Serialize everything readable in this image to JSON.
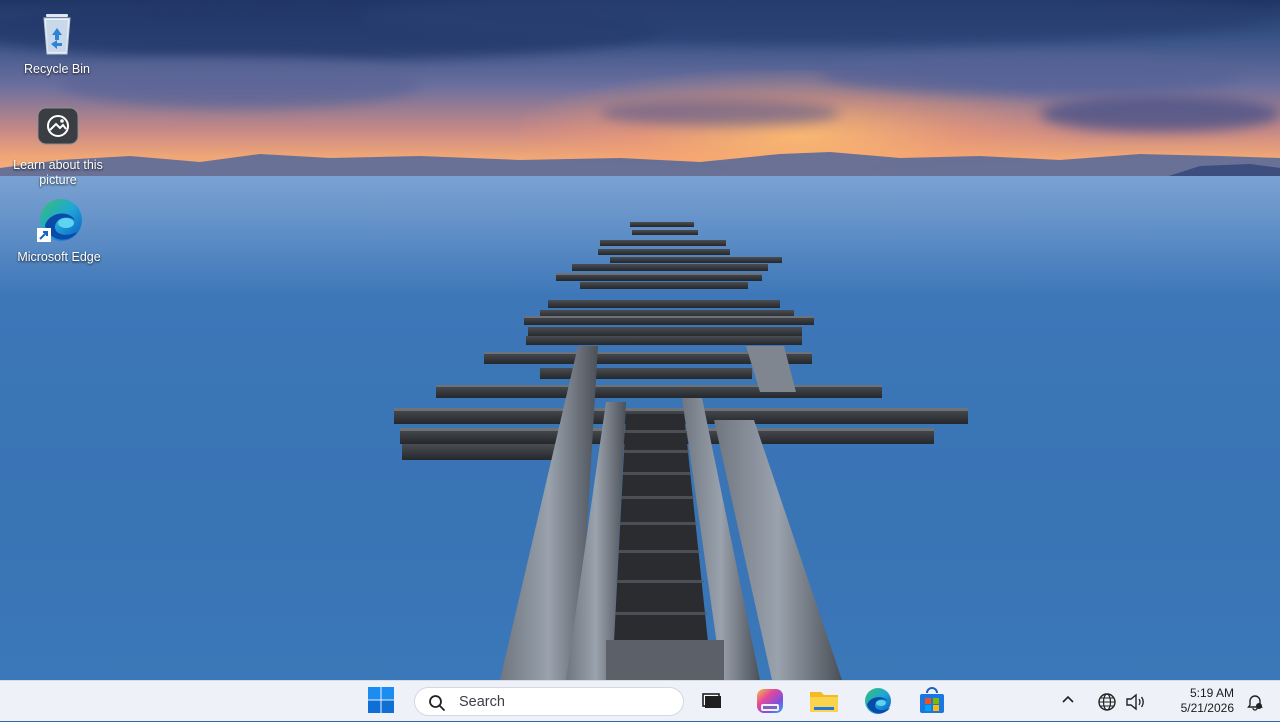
{
  "desktop": {
    "icons": [
      {
        "label": "Recycle Bin",
        "icon": "recycle-bin-icon"
      },
      {
        "label": "Learn about this picture",
        "icon": "camera-info-icon"
      },
      {
        "label": "Microsoft Edge",
        "icon": "edge-icon"
      }
    ]
  },
  "taskbar": {
    "start_icon": "windows-start-icon",
    "search": {
      "placeholder": "Search",
      "icon": "search-icon"
    },
    "apps": [
      {
        "name": "Task View",
        "icon": "task-view-icon"
      },
      {
        "name": "Copilot",
        "icon": "copilot-icon"
      },
      {
        "name": "File Explorer",
        "icon": "folder-icon"
      },
      {
        "name": "Microsoft Edge",
        "icon": "edge-icon"
      },
      {
        "name": "Microsoft Store",
        "icon": "store-icon"
      }
    ],
    "tray": {
      "chevron_icon": "chevron-up-icon",
      "network_icon": "globe-icon",
      "volume_icon": "volume-icon",
      "notification_icon": "notification-icon"
    },
    "clock": {
      "time": "5:19 AM",
      "date": "5/21/2026"
    }
  },
  "colors": {
    "taskbar_bg": "#eef2f8",
    "accent": "#0078d4",
    "sea": "#3a75b6"
  }
}
